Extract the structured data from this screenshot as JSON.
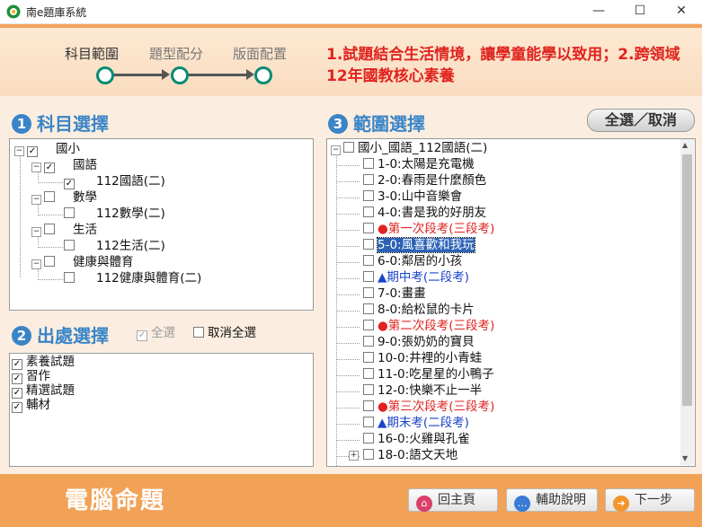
{
  "window": {
    "title": "南e題庫系統",
    "min": "—",
    "max": "☐",
    "close": "✕"
  },
  "steps": [
    {
      "label": "科目範圍",
      "active": true
    },
    {
      "label": "題型配分",
      "active": false
    },
    {
      "label": "版面配置",
      "active": false
    }
  ],
  "banner": {
    "line1": "1.試題結合生活情境，讓學童能學以致用；2.跨領域",
    "line2": "12年國教核心素養"
  },
  "colors": {
    "accent_blue": "#3a85c7",
    "orange": "#f1a257",
    "red": "#e0231f",
    "teal": "#0a8b73"
  },
  "section1": {
    "num": "1",
    "title": "科目選擇",
    "tree": [
      {
        "label": "國小",
        "checked": true,
        "exp": "−"
      },
      {
        "label": "國語",
        "checked": true,
        "exp": "−"
      },
      {
        "label": "112國語(二)",
        "checked": true
      },
      {
        "label": "數學",
        "checked": false,
        "exp": "−"
      },
      {
        "label": "112數學(二)",
        "checked": false
      },
      {
        "label": "生活",
        "checked": false,
        "exp": "−"
      },
      {
        "label": "112生活(二)",
        "checked": false
      },
      {
        "label": "健康與體育",
        "checked": false,
        "exp": "−"
      },
      {
        "label": "112健康與體育(二)",
        "checked": false
      }
    ]
  },
  "section2": {
    "num": "2",
    "title": "出處選擇",
    "select_all": "全選",
    "deselect_all": "取消全選",
    "items": [
      {
        "label": "素養試題",
        "checked": true
      },
      {
        "label": "習作",
        "checked": true
      },
      {
        "label": "精選試題",
        "checked": true
      },
      {
        "label": "輔材",
        "checked": true
      }
    ]
  },
  "section3": {
    "num": "3",
    "title": "範圍選擇",
    "toggle_all": "全選／取消",
    "root": "國小_國語_112國語(二)",
    "items": [
      {
        "label": "1-0:太陽是充電機",
        "style": "normal"
      },
      {
        "label": "2-0:春雨是什麼顏色",
        "style": "normal"
      },
      {
        "label": "3-0:山中音樂會",
        "style": "normal"
      },
      {
        "label": "4-0:書是我的好朋友",
        "style": "normal"
      },
      {
        "label": "●第一次段考(三段考)",
        "style": "red"
      },
      {
        "label": "5-0:風喜歡和我玩",
        "style": "selected"
      },
      {
        "label": "6-0:鄰居的小孩",
        "style": "normal"
      },
      {
        "label": "▲期中考(二段考)",
        "style": "blue"
      },
      {
        "label": "7-0:畫畫",
        "style": "normal"
      },
      {
        "label": "8-0:給松鼠的卡片",
        "style": "normal"
      },
      {
        "label": "●第二次段考(三段考)",
        "style": "red"
      },
      {
        "label": "9-0:張奶奶的寶貝",
        "style": "normal"
      },
      {
        "label": "10-0:井裡的小青蛙",
        "style": "normal"
      },
      {
        "label": "11-0:吃星星的小鴨子",
        "style": "normal"
      },
      {
        "label": "12-0:快樂不止一半",
        "style": "normal"
      },
      {
        "label": "●第三次段考(三段考)",
        "style": "red"
      },
      {
        "label": "▲期末考(二段考)",
        "style": "blue"
      },
      {
        "label": "16-0:火雞與孔雀",
        "style": "normal"
      },
      {
        "label": "18-0:語文天地",
        "style": "normal"
      }
    ]
  },
  "footer": {
    "title": "電腦命題",
    "home": "回主頁",
    "help": "輔助說明",
    "next": "下一步"
  }
}
